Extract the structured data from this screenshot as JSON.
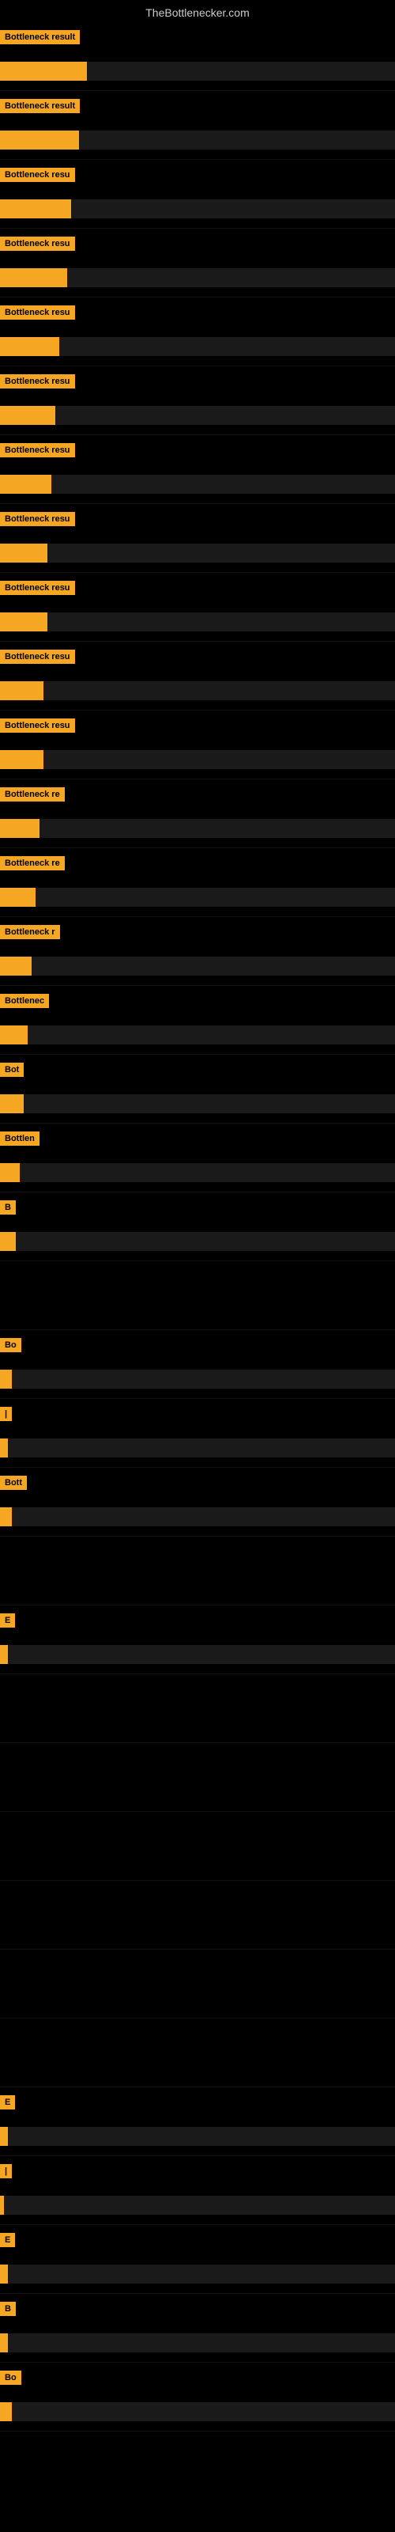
{
  "site": {
    "title": "TheBottlenecker.com"
  },
  "rows": [
    {
      "label": "Bottleneck result",
      "label_width": 105,
      "bar_width_pct": 22,
      "height": 87
    },
    {
      "label": "Bottleneck result",
      "label_width": 102,
      "bar_width_pct": 20,
      "height": 87
    },
    {
      "label": "Bottleneck resu",
      "label_width": 95,
      "bar_width_pct": 18,
      "height": 87
    },
    {
      "label": "Bottleneck resu",
      "label_width": 95,
      "bar_width_pct": 17,
      "height": 87
    },
    {
      "label": "Bottleneck resu",
      "label_width": 95,
      "bar_width_pct": 15,
      "height": 87
    },
    {
      "label": "Bottleneck resu",
      "label_width": 93,
      "bar_width_pct": 14,
      "height": 87
    },
    {
      "label": "Bottleneck resu",
      "label_width": 93,
      "bar_width_pct": 13,
      "height": 87
    },
    {
      "label": "Bottleneck resu",
      "label_width": 93,
      "bar_width_pct": 12,
      "height": 87
    },
    {
      "label": "Bottleneck resu",
      "label_width": 92,
      "bar_width_pct": 12,
      "height": 87
    },
    {
      "label": "Bottleneck resu",
      "label_width": 91,
      "bar_width_pct": 11,
      "height": 87
    },
    {
      "label": "Bottleneck resu",
      "label_width": 90,
      "bar_width_pct": 11,
      "height": 87
    },
    {
      "label": "Bottleneck re",
      "label_width": 80,
      "bar_width_pct": 10,
      "height": 87
    },
    {
      "label": "Bottleneck re",
      "label_width": 80,
      "bar_width_pct": 9,
      "height": 87
    },
    {
      "label": "Bottleneck r",
      "label_width": 75,
      "bar_width_pct": 8,
      "height": 87
    },
    {
      "label": "Bottlenec",
      "label_width": 60,
      "bar_width_pct": 7,
      "height": 87
    },
    {
      "label": "Bot",
      "label_width": 28,
      "bar_width_pct": 6,
      "height": 87
    },
    {
      "label": "Bottlen",
      "label_width": 48,
      "bar_width_pct": 5,
      "height": 87
    },
    {
      "label": "B",
      "label_width": 12,
      "bar_width_pct": 4,
      "height": 87
    },
    {
      "label": "",
      "label_width": 0,
      "bar_width_pct": 0,
      "height": 87
    },
    {
      "label": "Bo",
      "label_width": 18,
      "bar_width_pct": 3,
      "height": 87
    },
    {
      "label": "|",
      "label_width": 8,
      "bar_width_pct": 2,
      "height": 87
    },
    {
      "label": "Bott",
      "label_width": 30,
      "bar_width_pct": 3,
      "height": 87
    },
    {
      "label": "",
      "label_width": 0,
      "bar_width_pct": 0,
      "height": 87
    },
    {
      "label": "E",
      "label_width": 10,
      "bar_width_pct": 2,
      "height": 87
    },
    {
      "label": "",
      "label_width": 0,
      "bar_width_pct": 0,
      "height": 87
    },
    {
      "label": "",
      "label_width": 0,
      "bar_width_pct": 0,
      "height": 87
    },
    {
      "label": "",
      "label_width": 0,
      "bar_width_pct": 0,
      "height": 87
    },
    {
      "label": "",
      "label_width": 0,
      "bar_width_pct": 0,
      "height": 87
    },
    {
      "label": "",
      "label_width": 0,
      "bar_width_pct": 0,
      "height": 87
    },
    {
      "label": "",
      "label_width": 0,
      "bar_width_pct": 0,
      "height": 87
    },
    {
      "label": "E",
      "label_width": 10,
      "bar_width_pct": 2,
      "height": 87
    },
    {
      "label": "|",
      "label_width": 8,
      "bar_width_pct": 1,
      "height": 87
    },
    {
      "label": "E",
      "label_width": 10,
      "bar_width_pct": 2,
      "height": 87
    },
    {
      "label": "B",
      "label_width": 12,
      "bar_width_pct": 2,
      "height": 87
    },
    {
      "label": "Bo",
      "label_width": 18,
      "bar_width_pct": 3,
      "height": 87
    }
  ]
}
